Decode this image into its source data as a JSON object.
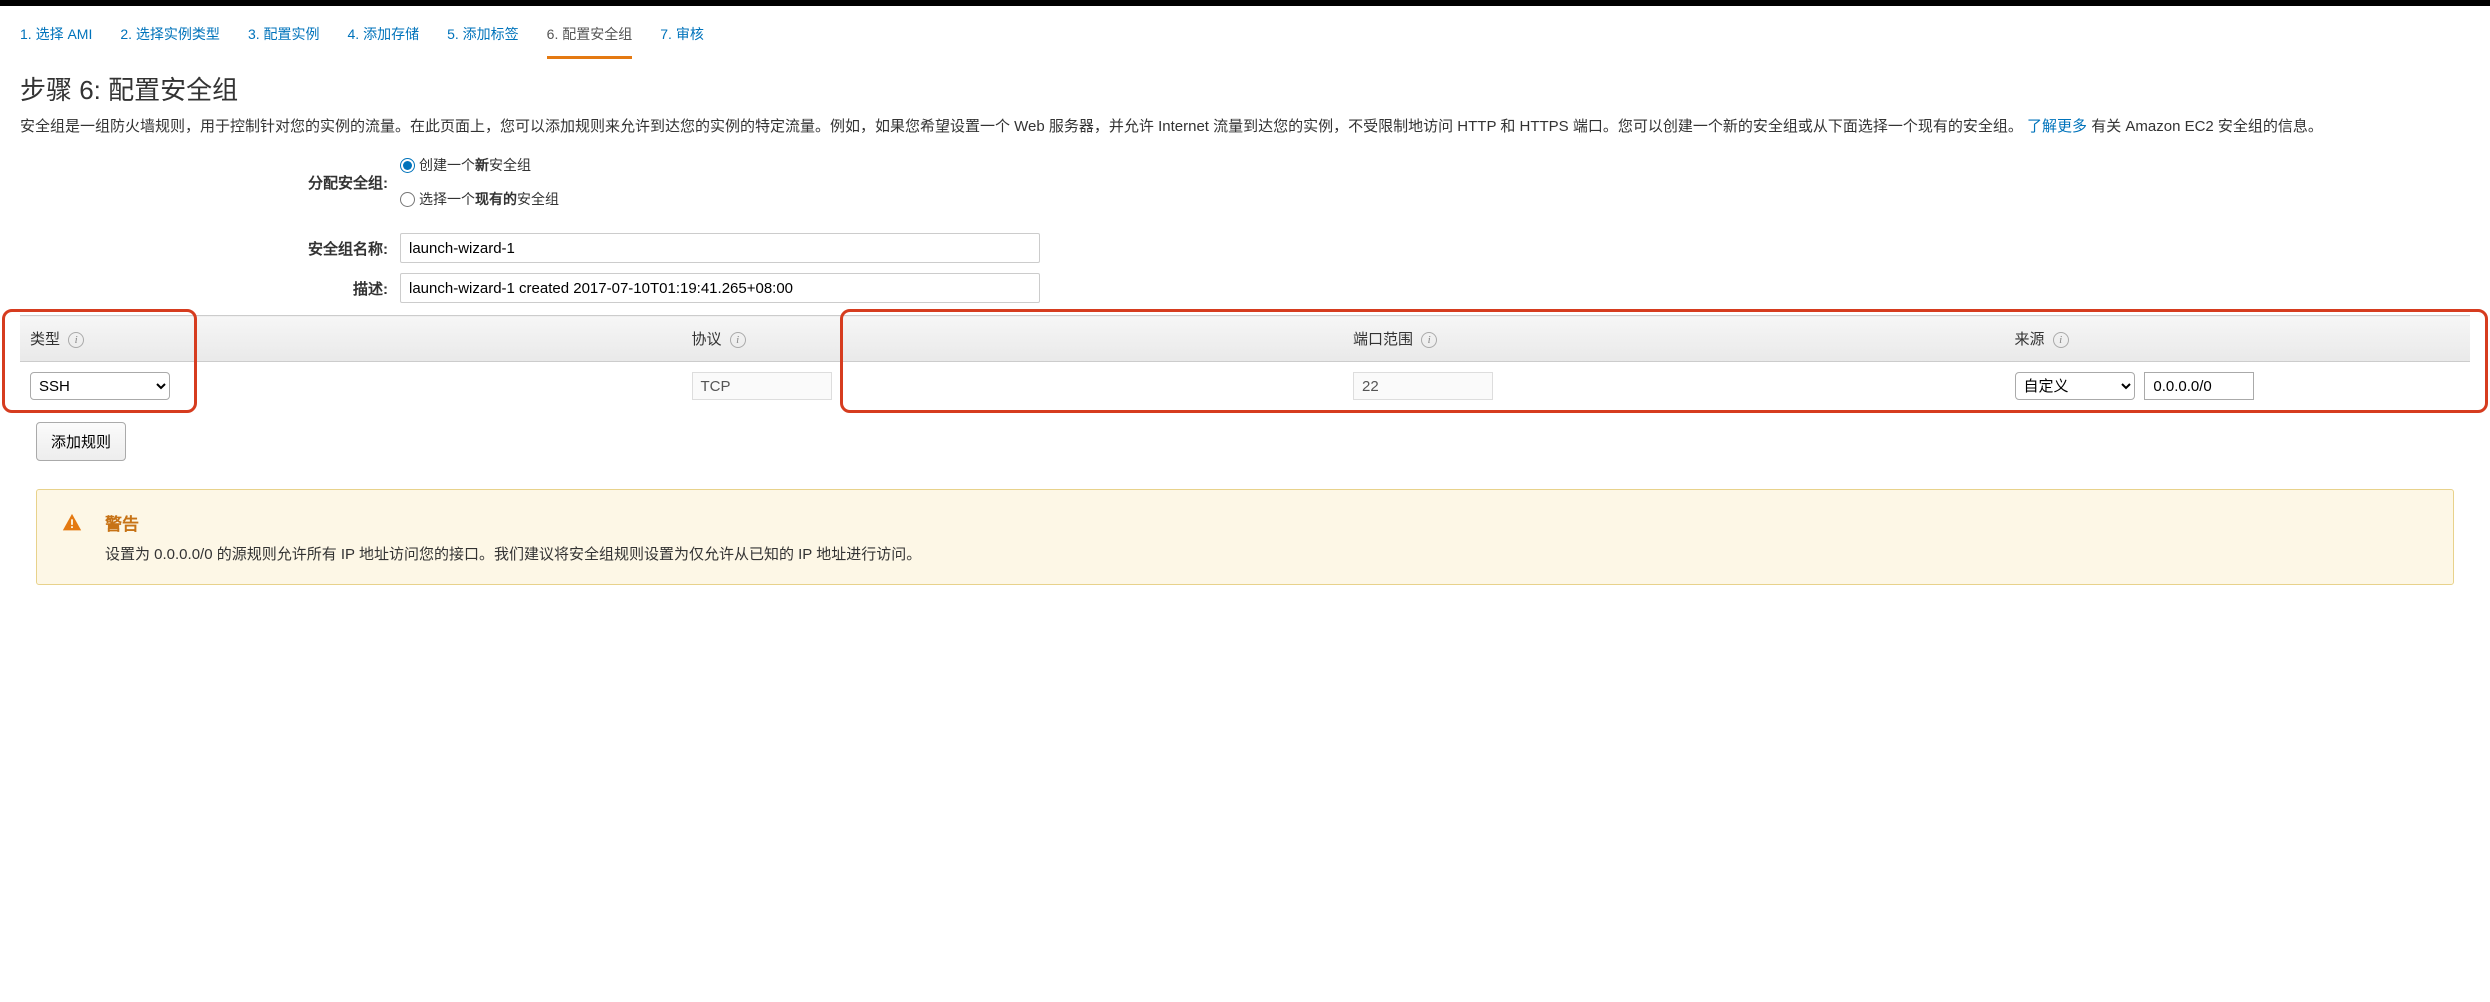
{
  "wizard": {
    "steps": [
      "1. 选择 AMI",
      "2. 选择实例类型",
      "3. 配置实例",
      "4. 添加存储",
      "5. 添加标签",
      "6. 配置安全组",
      "7. 审核"
    ],
    "active_index": 5
  },
  "page": {
    "title": "步骤 6: 配置安全组",
    "desc_before_link": "安全组是一组防火墙规则，用于控制针对您的实例的流量。在此页面上，您可以添加规则来允许到达您的实例的特定流量。例如，如果您希望设置一个 Web 服务器，并允许 Internet 流量到达您的实例，不受限制地访问 HTTP 和 HTTPS 端口。您可以创建一个新的安全组或从下面选择一个现有的安全组。",
    "learn_more": "了解更多",
    "desc_after_link": " 有关 Amazon EC2 安全组的信息。"
  },
  "form": {
    "assign_label": "分配安全组:",
    "radio_create_before": "创建一个",
    "radio_create_bold": "新",
    "radio_create_after": "安全组",
    "radio_select_before": "选择一个",
    "radio_select_bold": "现有的",
    "radio_select_after": "安全组",
    "name_label": "安全组名称:",
    "name_value": "launch-wizard-1",
    "desc_label": "描述:",
    "desc_value": "launch-wizard-1 created 2017-07-10T01:19:41.265+08:00"
  },
  "table": {
    "headers": {
      "type": "类型",
      "protocol": "协议",
      "port_range": "端口范围",
      "source": "来源"
    },
    "row": {
      "type": "SSH",
      "protocol": "TCP",
      "port": "22",
      "source_mode": "自定义",
      "source_value": "0.0.0.0/0"
    }
  },
  "buttons": {
    "add_rule": "添加规则"
  },
  "warning": {
    "title": "警告",
    "text": "设置为 0.0.0.0/0 的源规则允许所有 IP 地址访问您的接口。我们建议将安全组规则设置为仅允许从已知的 IP 地址进行访问。"
  },
  "info_glyph": "i"
}
